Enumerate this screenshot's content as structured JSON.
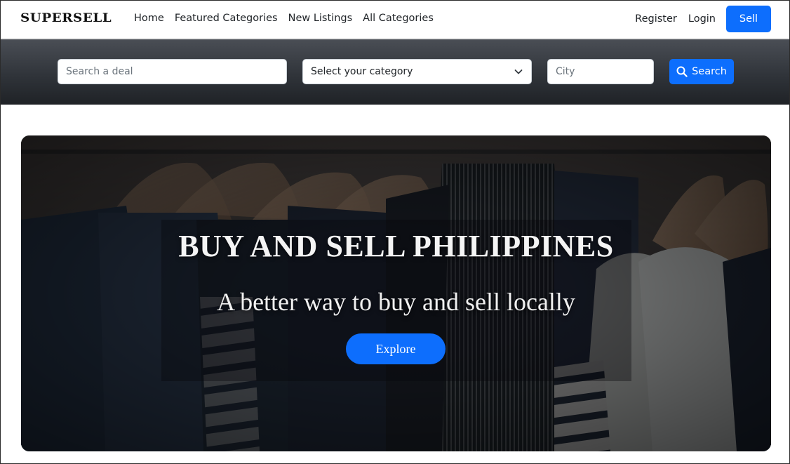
{
  "navbar": {
    "brand": "SUPERSELL",
    "links": [
      "Home",
      "Featured Categories",
      "New Listings",
      "All Categories"
    ],
    "register": "Register",
    "login": "Login",
    "sell": "Sell"
  },
  "search": {
    "deal_placeholder": "Search a deal",
    "category_selected": "Select your category",
    "city_placeholder": "City",
    "button": "Search"
  },
  "hero": {
    "title": "BUY AND SELL PHILIPPINES",
    "subtitle": "A better way to buy and sell locally",
    "button": "Explore"
  },
  "colors": {
    "accent": "#0d6efd",
    "searchbar_dark": "#30343a"
  },
  "icons": {
    "search": "search-icon",
    "dropdown": "chevron-down-icon"
  }
}
